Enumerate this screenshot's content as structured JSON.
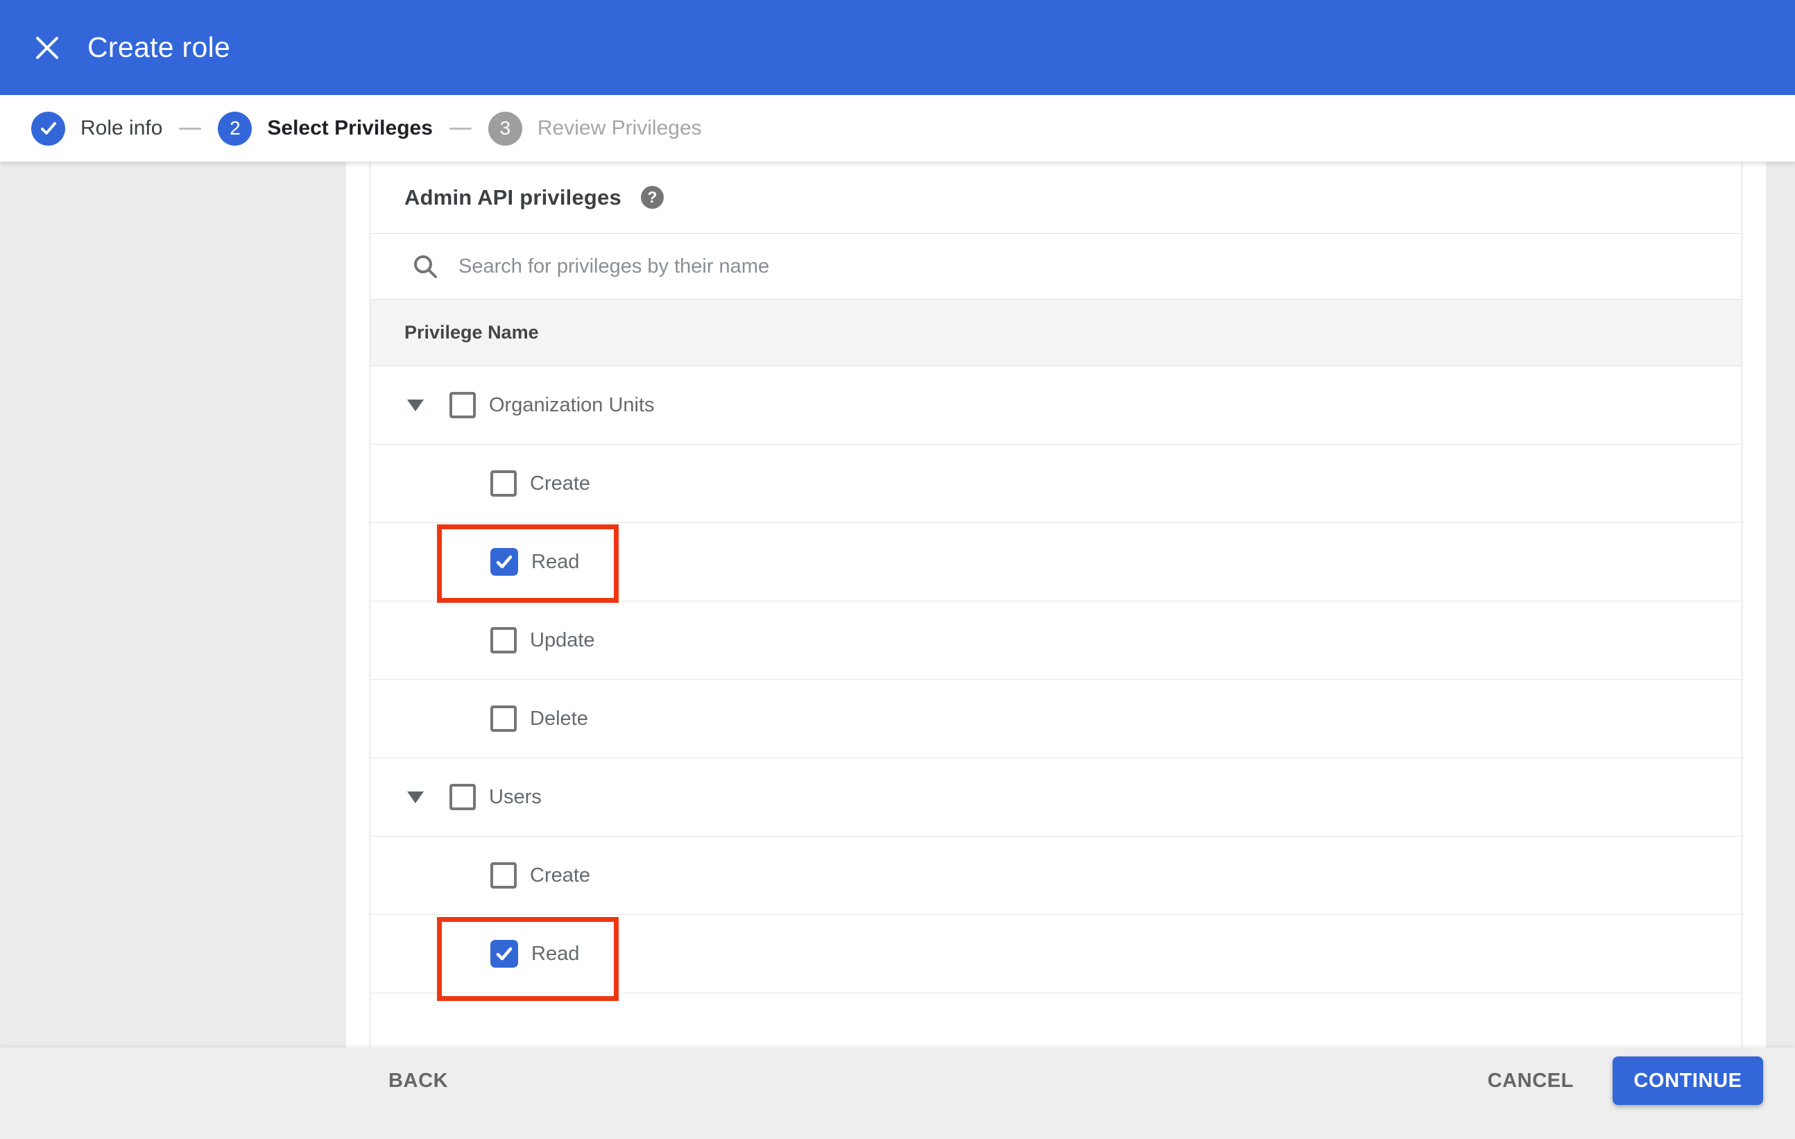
{
  "appbar": {
    "title": "Create role"
  },
  "stepper": {
    "step1": {
      "label": "Role info",
      "state": "complete"
    },
    "step2": {
      "number": "2",
      "label": "Select Privileges",
      "state": "active"
    },
    "step3": {
      "number": "3",
      "label": "Review Privileges",
      "state": "upcoming"
    }
  },
  "content": {
    "heading": "Admin API privileges",
    "help_icon": "?",
    "search_placeholder": "Search for privileges by their name",
    "column_header": "Privilege Name",
    "rows": [
      {
        "type": "group",
        "label": "Organization Units",
        "checked": false,
        "highlighted": false
      },
      {
        "type": "child",
        "label": "Create",
        "checked": false,
        "highlighted": false
      },
      {
        "type": "child",
        "label": "Read",
        "checked": true,
        "highlighted": true
      },
      {
        "type": "child",
        "label": "Update",
        "checked": false,
        "highlighted": false
      },
      {
        "type": "child",
        "label": "Delete",
        "checked": false,
        "highlighted": false
      },
      {
        "type": "group",
        "label": "Users",
        "checked": false,
        "highlighted": false
      },
      {
        "type": "child",
        "label": "Create",
        "checked": false,
        "highlighted": false
      },
      {
        "type": "child",
        "label": "Read",
        "checked": true,
        "highlighted": true
      }
    ]
  },
  "footer": {
    "back": "BACK",
    "cancel": "CANCEL",
    "continue": "CONTINUE"
  },
  "colors": {
    "appbar_blue": "#3366d9",
    "checkbox_blue": "#3367d6",
    "highlight_red": "#ee3712",
    "inactive_gray": "#9e9e9e",
    "page_bg": "#ececec"
  }
}
